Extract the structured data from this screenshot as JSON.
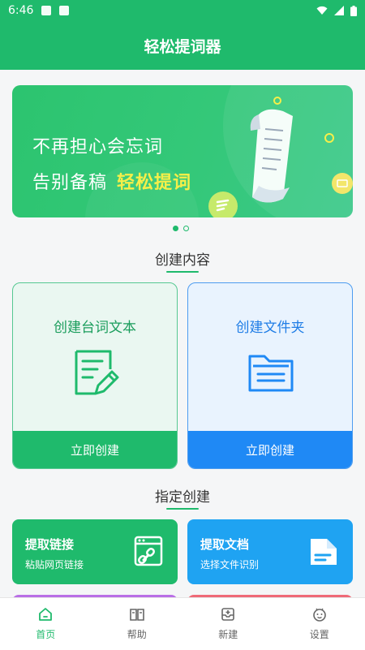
{
  "status_bar": {
    "time": "6:46"
  },
  "app_bar": {
    "title": "轻松提词器"
  },
  "banner": {
    "line1": "不再担心会忘词",
    "line2_prefix": "告别备稿",
    "line2_highlight": "轻松提词"
  },
  "create_section": {
    "title": "创建内容"
  },
  "cards": [
    {
      "title": "创建台词文本",
      "button": "立即创建",
      "icon": "edit-document-icon"
    },
    {
      "title": "创建文件夹",
      "button": "立即创建",
      "icon": "folder-icon"
    }
  ],
  "specify_section": {
    "title": "指定创建"
  },
  "tiles": [
    {
      "title": "提取链接",
      "subtitle": "粘贴网页链接",
      "icon": "link-browser-icon"
    },
    {
      "title": "提取文档",
      "subtitle": "选择文件识别",
      "icon": "document-file-icon"
    }
  ],
  "bottom_nav": [
    {
      "label": "首页",
      "icon": "home-icon",
      "active": true
    },
    {
      "label": "帮助",
      "icon": "book-icon",
      "active": false
    },
    {
      "label": "新建",
      "icon": "inbox-add-icon",
      "active": false
    },
    {
      "label": "设置",
      "icon": "face-settings-icon",
      "active": false
    }
  ],
  "colors": {
    "primary": "#1fba6c",
    "blue": "#1f89f5",
    "tile_blue": "#1fa3f2",
    "highlight": "#f6ef49"
  }
}
